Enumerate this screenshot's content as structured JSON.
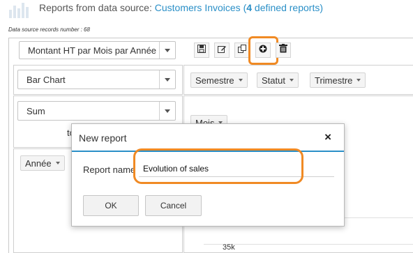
{
  "header": {
    "title_prefix": "Reports from data source: ",
    "source_name": "Customers Invoices",
    "open_paren": " (",
    "report_count": "4",
    "count_suffix": " defined reports)"
  },
  "meta": {
    "records_text": "Data source records number : 68"
  },
  "report_select": {
    "value": "Montant HT par Mois par Année"
  },
  "toolbar": {
    "buttons": [
      {
        "name": "save",
        "icon": "floppy-icon"
      },
      {
        "name": "edit",
        "icon": "edit-icon"
      },
      {
        "name": "copy",
        "icon": "copy-icon"
      },
      {
        "name": "add",
        "icon": "plus-circle-icon"
      },
      {
        "name": "delete",
        "icon": "trash-icon"
      }
    ],
    "highlight_color": "#f08a24"
  },
  "chart_type_select": {
    "value": "Bar Chart"
  },
  "aggregate_select": {
    "value": "Sum"
  },
  "partial_text": "to",
  "column_pills": [
    "Semestre",
    "Statut",
    "Trimestre"
  ],
  "row_pill": "Mois",
  "left_pill": "Année",
  "axis_tick": "35k",
  "modal": {
    "title": "New report",
    "close_symbol": "×",
    "field_label": "Report name",
    "field_value": "Evolution of sales",
    "ok_label": "OK",
    "cancel_label": "Cancel",
    "accent_color": "#2a8fc7"
  }
}
